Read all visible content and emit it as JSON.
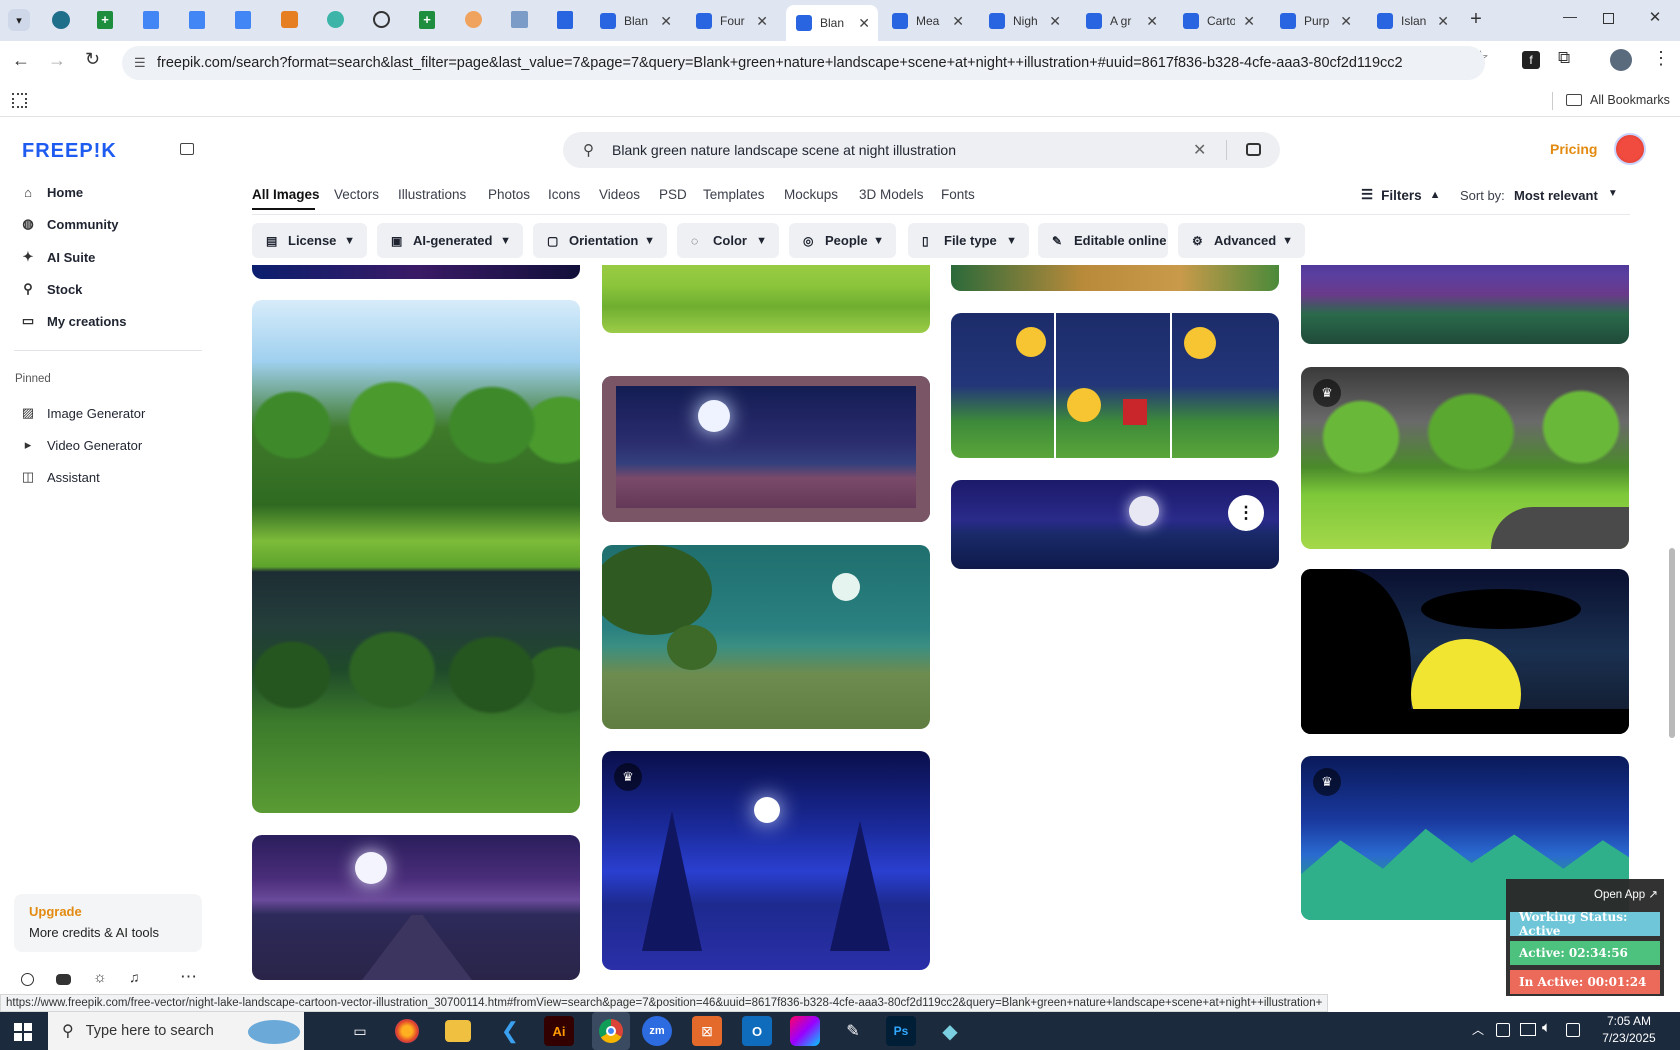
{
  "browser": {
    "tabs": [
      {
        "title": "Blan",
        "color": "#1a73e8"
      },
      {
        "title": "Four",
        "color": "#1a73e8"
      },
      {
        "title": "Blan",
        "color": "#1a73e8",
        "active": true
      },
      {
        "title": "Mea",
        "color": "#1a73e8"
      },
      {
        "title": "Nigh",
        "color": "#1a73e8"
      },
      {
        "title": "A gr",
        "color": "#1a73e8"
      },
      {
        "title": "Carto",
        "color": "#1a73e8"
      },
      {
        "title": "Purp",
        "color": "#1a73e8"
      },
      {
        "title": "Islan",
        "color": "#1a73e8"
      }
    ],
    "url": "freepik.com/search?format=search&last_filter=page&last_value=7&page=7&query=Blank+green+nature+landscape+scene+at+night++illustration+#uuid=8617f836-b328-4cfe-aaa3-80cf2d119cc2",
    "all_bookmarks": "All Bookmarks"
  },
  "sidebar": {
    "logo": "FREEP!K",
    "nav": [
      "Home",
      "Community",
      "AI Suite",
      "Stock",
      "My creations"
    ],
    "nav_icons": [
      "home-icon",
      "globe-icon",
      "sparkle-icon",
      "search-icon",
      "folder-icon"
    ],
    "pinned_label": "Pinned",
    "pinned": [
      "Image Generator",
      "Video Generator",
      "Assistant"
    ],
    "upgrade": {
      "title": "Upgrade",
      "subtitle": "More credits & AI tools"
    }
  },
  "header": {
    "search_query": "Blank green nature landscape scene at night  illustration",
    "pricing": "Pricing"
  },
  "categories": [
    "All Images",
    "Vectors",
    "Illustrations",
    "Photos",
    "Icons",
    "Videos",
    "PSD",
    "Templates",
    "Mockups",
    "3D Models",
    "Fonts"
  ],
  "filters_label": "Filters",
  "sort": {
    "label": "Sort by:",
    "value": "Most relevant"
  },
  "filter_buttons": [
    "License",
    "AI-generated",
    "Orientation",
    "Color",
    "People",
    "File type",
    "Editable online",
    "Advanced"
  ],
  "status_url": "https://www.freepik.com/free-vector/night-lake-landscape-cartoon-vector-illustration_30700114.htm#fromView=search&page=7&position=46&uuid=8617f836-b328-4cfe-aaa3-80cf2d119cc2&query=Blank+green+nature+landscape+scene+at+night++illustration+",
  "widget": {
    "open_app": "Open App ↗",
    "working": "Working Status: Active",
    "active": "Active: 02:34:56",
    "inactive": "In Active: 00:01:24"
  },
  "taskbar": {
    "search_placeholder": "Type here to search",
    "time": "7:05 AM",
    "date": "7/23/2025"
  }
}
